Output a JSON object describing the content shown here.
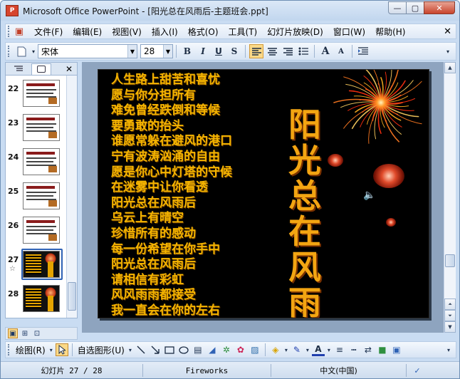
{
  "window": {
    "app_icon_text": "P",
    "title": "Microsoft Office PowerPoint - [阳光总在风雨后-主题班会.ppt]",
    "minimize": "—",
    "restore": "▢",
    "close": "✕"
  },
  "menubar": {
    "items": [
      "文件(F)",
      "编辑(E)",
      "视图(V)",
      "插入(I)",
      "格式(O)",
      "工具(T)",
      "幻灯片放映(D)",
      "窗口(W)",
      "帮助(H)"
    ],
    "close_glyph": "✕"
  },
  "toolbar": {
    "font_name": "宋体",
    "font_size": "28",
    "bold": "B",
    "italic": "I",
    "underline": "U",
    "shadow": "S",
    "increase_font": "A",
    "decrease_font": "A"
  },
  "panel": {
    "close_glyph": "✕",
    "slides": [
      {
        "number": "22",
        "dark": false
      },
      {
        "number": "23",
        "dark": false
      },
      {
        "number": "24",
        "dark": false
      },
      {
        "number": "25",
        "dark": false
      },
      {
        "number": "26",
        "dark": false
      },
      {
        "number": "27",
        "dark": true,
        "selected": true
      },
      {
        "number": "28",
        "dark": true
      }
    ]
  },
  "slide": {
    "poem_lines": [
      "人生路上甜苦和喜忧",
      "愿与你分担所有",
      "难免曾经跌倒和等候",
      "要勇敢的抬头",
      "谁愿常躲在避风的港口",
      "宁有波涛汹涌的自由",
      "愿是你心中灯塔的守候",
      "在迷雾中让你看透",
      "阳光总在风雨后",
      "乌云上有晴空",
      "珍惜所有的感动",
      "每一份希望在你手中",
      "阳光总在风雨后",
      "请相信有彩虹",
      "风风雨雨都接受",
      "我一直会在你的左右"
    ],
    "vertical_title": "阳光总在风雨后",
    "colors": {
      "text": "#f4b400",
      "background": "#000000"
    }
  },
  "drawbar": {
    "draw_label": "绘图(R)",
    "autoshapes_label": "自选图形(U)"
  },
  "statusbar": {
    "slide_info": "幻灯片 27 / 28",
    "design": "Fireworks",
    "language": "中文(中国)"
  }
}
